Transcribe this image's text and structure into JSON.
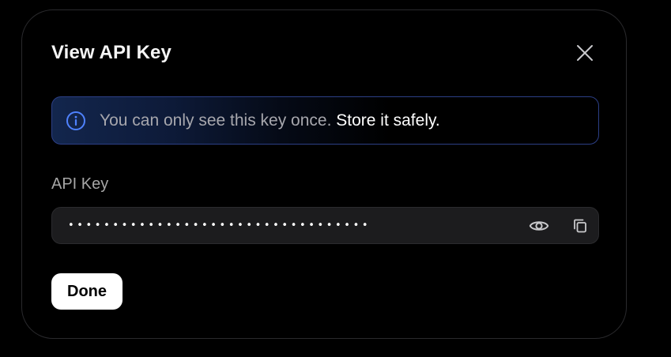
{
  "dialog": {
    "title": "View API Key",
    "close_label": "Close"
  },
  "notice": {
    "icon": "info-icon",
    "text": "You can only see this key once.",
    "emphasis": "Store it safely.",
    "accent_color": "#4f82ff"
  },
  "api_key": {
    "label": "API Key",
    "masked_value": "••••••••••••••••••••••••••••••••••",
    "toggle_icon": "eye-icon",
    "copy_icon": "copy-icon"
  },
  "actions": {
    "done_label": "Done"
  }
}
